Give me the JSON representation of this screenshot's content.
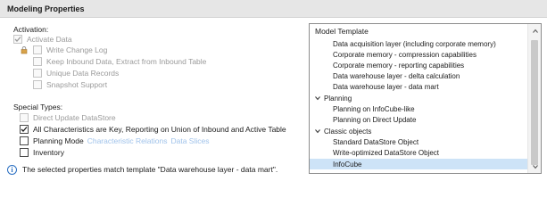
{
  "section": {
    "title": "Modeling Properties"
  },
  "activation": {
    "label": "Activation:",
    "activate_data": "Activate Data",
    "write_change_log": "Write Change Log",
    "keep_inbound": "Keep Inbound Data, Extract from Inbound Table",
    "unique_records": "Unique Data Records",
    "snapshot_support": "Snapshot Support"
  },
  "special_types": {
    "label": "Special Types:",
    "direct_update": "Direct Update DataStore",
    "all_characteristics": "All Characteristics are Key, Reporting on Union of Inbound and Active Table",
    "planning_mode": "Planning Mode",
    "characteristic_relations": "Characteristic Relations",
    "data_slices": "Data Slices",
    "inventory": "Inventory"
  },
  "info": {
    "message": "The selected properties match template \"Data warehouse layer - data mart\"."
  },
  "template_tree": {
    "header": "Model Template",
    "items": [
      "Data acquisition layer (including corporate memory)",
      "Corporate memory - compression capabilities",
      "Corporate memory - reporting capabilities",
      "Data warehouse layer - delta calculation",
      "Data warehouse layer - data mart",
      "Planning",
      "Planning on InfoCube-like",
      "Planning on Direct Update",
      "Classic objects",
      "Standard DataStore Object",
      "Write-optimized DataStore Object",
      "InfoCube"
    ]
  },
  "colors": {
    "link": "#9fc2ea",
    "selected_row": "#cde3f7",
    "info_icon": "#2a6fc2"
  }
}
